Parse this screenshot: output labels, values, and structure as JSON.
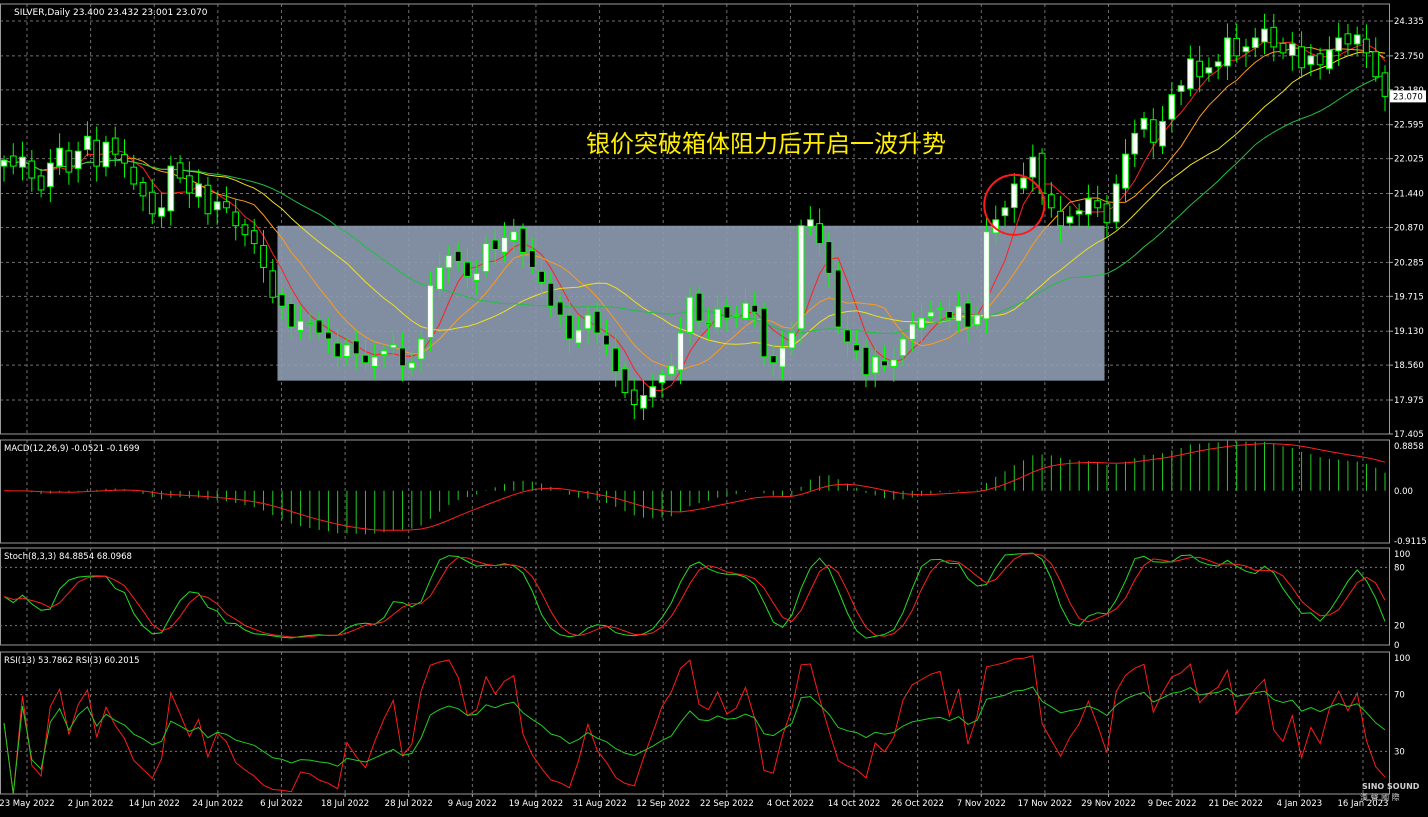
{
  "header": {
    "title": "SILVER,Daily  23.400 23.432 23.001 23.070"
  },
  "annotation": {
    "text": "银价突破箱体阻力后开启一波升势"
  },
  "watermark": {
    "line1": "SINO SOUND",
    "line2": "漢 聲 國 際"
  },
  "colors": {
    "background": "#000000",
    "grid": "#6f6f6f",
    "bull_candle": "#ffffff",
    "bear_candle": "#000000",
    "candle_outline": "#00ff00",
    "ma_red": "#ff2020",
    "ma_orange": "#ff9b1a",
    "ma_yellow": "#f0e020",
    "ma_green": "#20c040",
    "box_fill": "#8f9cb3",
    "annotation_text": "#ffee00",
    "circle": "#ff1a1a",
    "macd_hist": "#22cc22",
    "macd_signal": "#ff2020",
    "stoch_main": "#22dd22",
    "stoch_signal": "#ff2020",
    "rsi_fast": "#ff1a1a",
    "rsi_slow": "#22cc22",
    "axis_text": "#ffffff"
  },
  "chart_data": [
    {
      "type": "candlestick",
      "symbol": "SILVER",
      "timeframe": "Daily",
      "ohlc_last": {
        "open": 23.4,
        "high": 23.432,
        "low": 23.001,
        "close": 23.07
      },
      "current_price": "23.070",
      "ylim": [
        17.405,
        24.62
      ],
      "y_ticks": [
        "24.335",
        "23.750",
        "23.180",
        "22.595",
        "22.025",
        "21.440",
        "20.870",
        "20.285",
        "19.715",
        "19.130",
        "18.560",
        "17.975",
        "17.405"
      ],
      "x_ticks": [
        "23 May 2022",
        "2 Jun 2022",
        "14 Jun 2022",
        "24 Jun 2022",
        "6 Jul 2022",
        "18 Jul 2022",
        "28 Jul 2022",
        "9 Aug 2022",
        "19 Aug 2022",
        "31 Aug 2022",
        "12 Sep 2022",
        "22 Sep 2022",
        "4 Oct 2022",
        "14 Oct 2022",
        "26 Oct 2022",
        "7 Nov 2022",
        "17 Nov 2022",
        "29 Nov 2022",
        "9 Dec 2022",
        "21 Dec 2022",
        "4 Jan 2023",
        "16 Jan 2023"
      ],
      "box_range": {
        "from_date": "6 Jul 2022",
        "to_date": "29 Nov 2022",
        "top": 20.9,
        "bottom": 18.3
      },
      "close_series": [
        22.0,
        21.9,
        22.05,
        21.7,
        21.5,
        21.95,
        22.2,
        21.8,
        22.15,
        22.4,
        21.9,
        22.3,
        22.1,
        21.95,
        21.6,
        21.4,
        21.1,
        21.2,
        21.9,
        21.7,
        21.45,
        21.6,
        21.1,
        21.3,
        21.2,
        20.9,
        20.75,
        20.6,
        20.2,
        19.7,
        19.55,
        19.2,
        19.3,
        19.25,
        19.1,
        19.0,
        18.7,
        18.9,
        18.75,
        18.6,
        18.7,
        18.8,
        18.9,
        18.55,
        18.6,
        19.0,
        19.9,
        20.2,
        20.4,
        20.3,
        20.05,
        20.1,
        20.6,
        20.5,
        20.7,
        20.8,
        20.45,
        20.2,
        19.95,
        19.55,
        19.4,
        19.0,
        19.15,
        19.4,
        19.1,
        18.9,
        18.45,
        18.1,
        17.9,
        18.05,
        18.2,
        18.4,
        18.55,
        19.1,
        19.7,
        19.3,
        19.25,
        19.5,
        19.35,
        19.4,
        19.6,
        19.45,
        18.7,
        18.6,
        18.85,
        19.1,
        20.9,
        21.0,
        20.6,
        20.1,
        19.2,
        18.95,
        18.8,
        18.4,
        18.7,
        18.55,
        18.65,
        19.0,
        19.25,
        19.35,
        19.45,
        19.5,
        19.35,
        19.55,
        19.2,
        19.4,
        20.8,
        21.0,
        21.2,
        21.6,
        21.7,
        22.05,
        21.45,
        21.2,
        20.9,
        21.05,
        21.15,
        21.35,
        21.2,
        20.95,
        21.6,
        22.1,
        22.45,
        22.7,
        22.3,
        22.65,
        23.1,
        23.25,
        23.7,
        23.4,
        23.55,
        23.65,
        24.05,
        23.75,
        23.9,
        24.05,
        24.2,
        23.9,
        23.8,
        23.95,
        23.55,
        23.75,
        23.6,
        23.85,
        24.05,
        23.95,
        24.1,
        23.8,
        23.4,
        23.07
      ]
    },
    {
      "type": "line",
      "name": "MACD(12,26,9) -0.0521 -0.1699",
      "ylim": [
        -0.9115,
        0.8858
      ],
      "y_ticks": [
        "0.8858",
        "0.00",
        "-0.9115"
      ]
    },
    {
      "type": "line",
      "name": "Stoch(8,3,3) 84.8854 68.0968",
      "ylim": [
        0,
        100
      ],
      "y_ticks": [
        "100",
        "80",
        "20",
        "0"
      ]
    },
    {
      "type": "line",
      "name": "RSI(13) 53.7862  RSI(3) 60.2015",
      "ylim": [
        0,
        100
      ],
      "y_ticks": [
        "100",
        "70",
        "30"
      ]
    }
  ]
}
